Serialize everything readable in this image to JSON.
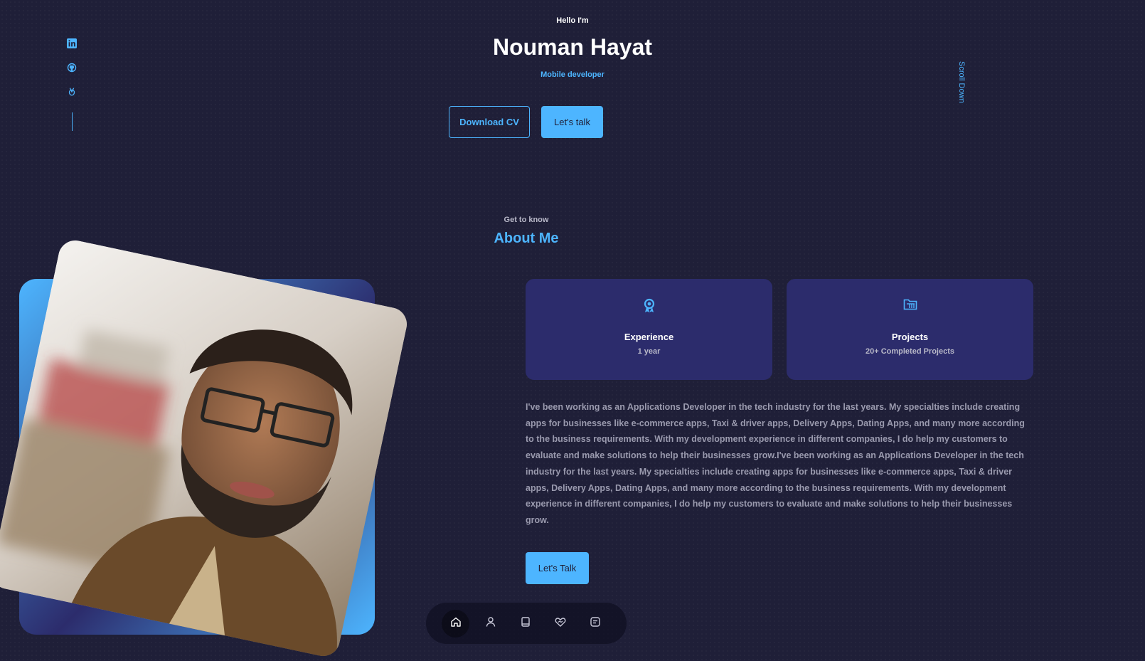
{
  "hero": {
    "greeting": "Hello I'm",
    "name": "Nouman Hayat",
    "role": "Mobile developer",
    "download_cv": "Download CV",
    "lets_talk": "Let's talk",
    "scroll_down": "Scroll Down"
  },
  "socials": [
    {
      "icon": "linkedin-icon"
    },
    {
      "icon": "github-icon"
    },
    {
      "icon": "dribbble-icon"
    }
  ],
  "about": {
    "kicker": "Get to know",
    "title": "About Me",
    "cards": [
      {
        "icon": "award-icon",
        "title": "Experience",
        "subtitle": "1 year"
      },
      {
        "icon": "folder-icon",
        "title": "Projects",
        "subtitle": "20+ Completed Projects"
      }
    ],
    "paragraph": "I've been working as an Applications Developer in the tech industry for the last years. My specialties include creating apps for businesses like e-commerce apps, Taxi & driver apps, Delivery Apps, Dating Apps, and many more according to the business requirements. With my development experience in different companies, I do help my customers to evaluate and make solutions to help their businesses grow.I've been working as an Applications Developer in the tech industry for the last years. My specialties include creating apps for businesses like e-commerce apps, Taxi & driver apps, Delivery Apps, Dating Apps, and many more according to the business requirements. With my development experience in different companies, I do help my customers to evaluate and make solutions to help their businesses grow.",
    "cta": "Let's Talk"
  },
  "nav": {
    "items": [
      {
        "icon": "home-icon",
        "active": true
      },
      {
        "icon": "user-icon",
        "active": false
      },
      {
        "icon": "book-icon",
        "active": false
      },
      {
        "icon": "services-icon",
        "active": false
      },
      {
        "icon": "message-icon",
        "active": false
      }
    ]
  },
  "colors": {
    "background": "#1f1f38",
    "accent": "#4db5ff",
    "card": "#2c2c6c",
    "text_muted": "#9a9aae"
  }
}
